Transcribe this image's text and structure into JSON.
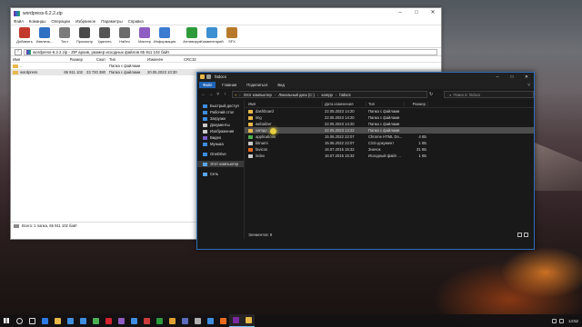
{
  "winrar": {
    "title": "wordpress-6.2.2.zip",
    "menu": [
      "Файл",
      "Команды",
      "Операции",
      "Избранное",
      "Параметры",
      "Справка"
    ],
    "toolbar": [
      {
        "label": "Добавить",
        "icon": "add-icon",
        "color": "#c0392b"
      },
      {
        "label": "Извлечь...",
        "icon": "extract-icon",
        "color": "#2e6fc2"
      },
      {
        "label": "Тест",
        "icon": "test-icon",
        "color": "#7b7b7b"
      },
      {
        "label": "Просмотр",
        "icon": "view-icon",
        "color": "#4a4a4a"
      },
      {
        "label": "Удалить",
        "icon": "delete-icon",
        "color": "#555555"
      },
      {
        "label": "Найти",
        "icon": "find-icon",
        "color": "#6c6c6c"
      },
      {
        "label": "Мастер",
        "icon": "wizard-icon",
        "color": "#8e5cc2"
      },
      {
        "label": "Информация",
        "icon": "info-icon",
        "color": "#3b7bd0"
      },
      {
        "label": "Антивирус",
        "icon": "antivirus-icon",
        "color": "#2d9b3a"
      },
      {
        "label": "Комментарий",
        "icon": "comment-icon",
        "color": "#3c8fd0"
      },
      {
        "label": "SFX",
        "icon": "sfx-icon",
        "color": "#b87a2a"
      }
    ],
    "path": "wordpress-6.2.2.zip - ZIP архив, размер исходных файлов 65 911 102 байт",
    "columns": [
      "Имя",
      "Размер",
      "Сжат",
      "Тип",
      "Изменён",
      "CRC32"
    ],
    "rows": [
      {
        "name": "..",
        "size": "",
        "packed": "",
        "type": "Папка с файлами",
        "modified": "",
        "crc": ""
      },
      {
        "name": "wordpress",
        "size": "65 911 102",
        "packed": "23 720 380",
        "type": "Папка с файлами",
        "modified": "20.05.2023 10:30",
        "crc": ""
      }
    ],
    "status": "Всего: 1 папка, 65 911 102 байт"
  },
  "explorer": {
    "title": "htdocs",
    "ribbon": [
      "Файл",
      "Главная",
      "Поделиться",
      "Вид"
    ],
    "breadcrumb": [
      "Этот компьютер",
      "Локальный диск (C:)",
      "xampp",
      "htdocs"
    ],
    "search_placeholder": "Поиск в: htdocs",
    "sidebar": [
      {
        "label": "Быстрый доступ",
        "icon": "star-icon",
        "color": "#3d8ee0"
      },
      {
        "label": "Рабочий стол",
        "icon": "desktop-icon",
        "color": "#3d8ee0"
      },
      {
        "label": "Загрузки",
        "icon": "download-icon",
        "color": "#3d8ee0"
      },
      {
        "label": "Документы",
        "icon": "documents-icon",
        "color": "#c9c9c9"
      },
      {
        "label": "Изображения",
        "icon": "pictures-icon",
        "color": "#c9c9c9"
      },
      {
        "label": "Видео",
        "icon": "videos-icon",
        "color": "#7a5bc7"
      },
      {
        "label": "Музыка",
        "icon": "music-icon",
        "color": "#3d8ee0"
      },
      {
        "label": "OneDrive",
        "icon": "onedrive-icon",
        "color": "#3d8ee0"
      },
      {
        "label": "Этот компьютер",
        "icon": "computer-icon",
        "color": "#5aa7e8"
      },
      {
        "label": "Сеть",
        "icon": "network-icon",
        "color": "#5aa7e8"
      }
    ],
    "columns": [
      "Имя",
      "Дата изменения",
      "Тип",
      "Размер"
    ],
    "rows": [
      {
        "name": "dashboard",
        "date": "22.05.2023 14:20",
        "type": "Папка с файлами",
        "size": "",
        "icon": "folder-icon",
        "color": "#e8b84a"
      },
      {
        "name": "img",
        "date": "22.05.2023 14:20",
        "type": "Папка с файлами",
        "size": "",
        "icon": "folder-icon",
        "color": "#e8b84a"
      },
      {
        "name": "webalizer",
        "date": "22.05.2023 14:20",
        "type": "Папка с файлами",
        "size": "",
        "icon": "folder-icon",
        "color": "#e8b84a"
      },
      {
        "name": "xampp",
        "date": "22.05.2023 14:22",
        "type": "Папка с файлами",
        "size": "",
        "icon": "folder-icon",
        "color": "#e8b84a"
      },
      {
        "name": "applications",
        "date": "15.06.2022 22:07",
        "type": "Chrome HTML Do...",
        "size": "4 КБ",
        "icon": "chrome-icon",
        "color": "#4caf50"
      },
      {
        "name": "bitnami",
        "date": "15.06.2022 22:07",
        "type": "CSS-документ",
        "size": "1 КБ",
        "icon": "css-icon",
        "color": "#c9c9c9"
      },
      {
        "name": "favicon",
        "date": "16.07.2015 15:32",
        "type": "Значок",
        "size": "31 КБ",
        "icon": "favicon-icon",
        "color": "#e76a1f"
      },
      {
        "name": "index",
        "date": "16.07.2015 15:32",
        "type": "Исходный файл ...",
        "size": "1 КБ",
        "icon": "php-icon",
        "color": "#c9c9c9"
      }
    ],
    "status": "Элементов: 8"
  },
  "taskbar": {
    "apps": [
      {
        "icon": "search-icon",
        "color": "#dddddd"
      },
      {
        "icon": "task-view-icon",
        "color": "#dddddd"
      },
      {
        "icon": "edge-icon",
        "color": "#2c7be5"
      },
      {
        "icon": "explorer-icon",
        "color": "#e8b84a"
      },
      {
        "icon": "store-icon",
        "color": "#3d8ee0"
      },
      {
        "icon": "mail-icon",
        "color": "#3d8ee0"
      },
      {
        "icon": "chrome-icon",
        "color": "#4caf50"
      },
      {
        "icon": "opera-icon",
        "color": "#d4232f"
      },
      {
        "icon": "app-icon",
        "color": "#8e5cc2"
      },
      {
        "icon": "app-icon",
        "color": "#3d8ee0"
      },
      {
        "icon": "app-icon",
        "color": "#cc3b3b"
      },
      {
        "icon": "app-icon",
        "color": "#2d9b3a"
      },
      {
        "icon": "app-icon",
        "color": "#e0a030"
      },
      {
        "icon": "app-icon",
        "color": "#5c6bc0"
      },
      {
        "icon": "app-icon",
        "color": "#b0b0b0"
      },
      {
        "icon": "app-icon",
        "color": "#3d8ee0"
      },
      {
        "icon": "app-icon",
        "color": "#e76a1f"
      },
      {
        "icon": "winrar-icon",
        "color": "#7a2aa0"
      },
      {
        "icon": "explorer-icon",
        "color": "#e8b84a"
      }
    ],
    "clock": "14:52"
  }
}
